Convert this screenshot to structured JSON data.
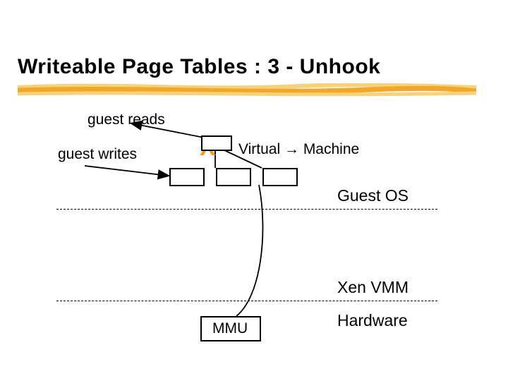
{
  "title": "Writeable Page Tables : 3 - Unhook",
  "guest_reads": "guest reads",
  "guest_writes": "guest writes",
  "virtual_machine": "Virtual → Machine",
  "x_mark": "X",
  "guest_os": "Guest OS",
  "xen_vmm": "Xen VMM",
  "hardware": "Hardware",
  "mmu": "MMU",
  "colors": {
    "accent": "#f59b1c",
    "underline_primary": "#f2a72b",
    "underline_secondary": "#f8d27a"
  }
}
